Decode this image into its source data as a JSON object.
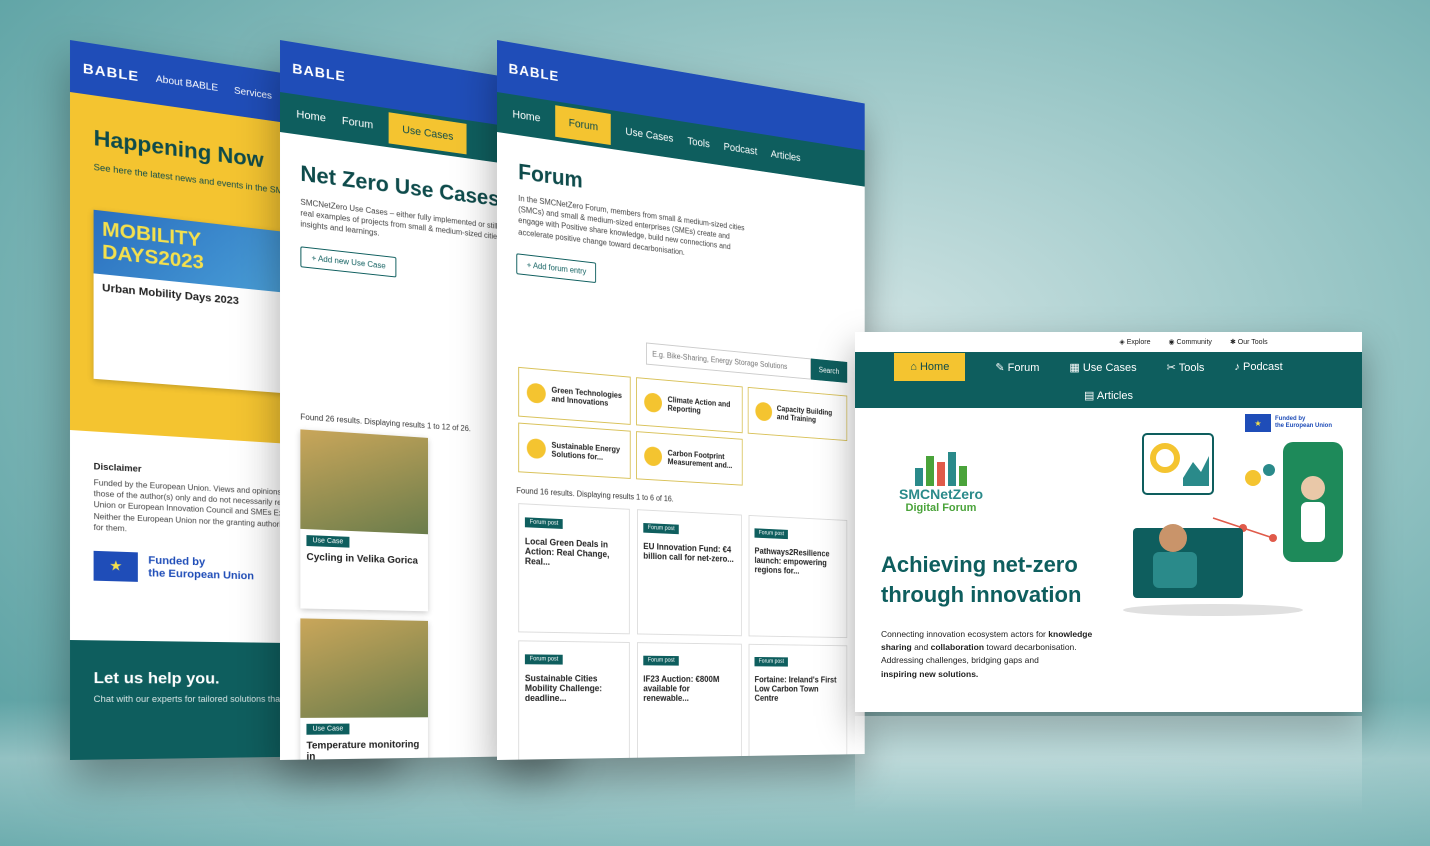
{
  "brand": {
    "logo": "BABLE"
  },
  "panel_happening": {
    "nav": [
      "About BABLE",
      "Services"
    ],
    "title": "Happening Now",
    "text": "See here the latest news and events in the SMCNetZero Project.",
    "event_banner": "MOBILITY DAYS2023",
    "event_name": "Urban Mobility Days 2023",
    "disclaimer_title": "Disclaimer",
    "disclaimer": "Funded by the European Union. Views and opinions expressed are however those of the author(s) only and do not necessarily reflect those of the European Union or European Innovation Council and SMEs Executive Agency (EISMEA). Neither the European Union nor the granting authority can be held responsible for them.",
    "funded_line1": "Funded by",
    "funded_line2": "the European Union",
    "help_title": "Let us help you.",
    "help_sub": "Chat with our experts for tailored solutions that fit your"
  },
  "panel_usecases": {
    "nav": [
      "Home",
      "Forum",
      "Use Cases"
    ],
    "title": "Net Zero Use Cases",
    "text": "SMCNetZero Use Cases – either fully implemented or still ongoing – are real examples of projects from small & medium-sized cities (SMCs) with insights and learnings.",
    "add_button": "+ Add new Use Case",
    "results": "Found 26 results. Displaying results 1 to 12 of 26.",
    "cards": [
      {
        "tag": "Use Case",
        "title": "Cycling in Velika Gorica"
      },
      {
        "tag": "Use Case",
        "title": "Temperature monitoring in"
      }
    ]
  },
  "panel_forum": {
    "nav": [
      "Home",
      "Forum",
      "Use Cases",
      "Tools",
      "Podcast",
      "Articles"
    ],
    "title": "Forum",
    "text": "In the SMCNetZero Forum, members from small & medium-sized cities (SMCs) and small & medium-sized enterprises (SMEs) create and engage with Positive share knowledge, build new connections and accelerate positive change toward decarbonisation.",
    "add_button": "+ Add forum entry",
    "search_placeholder": "E.g. Bike-Sharing, Energy Storage Solutions",
    "search_button": "Search",
    "topics": [
      "Green Technologies and Innovations",
      "Climate Action and Reporting",
      "Capacity Building and Training",
      "Sustainable Energy Solutions for...",
      "Carbon Footprint Measurement and..."
    ],
    "results": "Found 16 results. Displaying results 1 to 6 of 16.",
    "posts": [
      {
        "tag": "Forum post",
        "title": "Local Green Deals in Action: Real Change, Real..."
      },
      {
        "tag": "Forum post",
        "title": "EU Innovation Fund: €4 billion call for net-zero..."
      },
      {
        "tag": "Forum post",
        "title": "Pathways2Resilience launch: empowering regions for..."
      },
      {
        "tag": "Forum post",
        "title": "Sustainable Cities Mobility Challenge: deadline..."
      },
      {
        "tag": "Forum post",
        "title": "IF23 Auction: €800M available for renewable..."
      },
      {
        "tag": "Forum post",
        "title": "Fortaine: Ireland's First Low Carbon Town Centre"
      }
    ]
  },
  "front": {
    "util": [
      "Explore",
      "Community",
      "Our Tools"
    ],
    "nav_row1": [
      "Home",
      "Forum",
      "Use Cases",
      "Tools",
      "Podcast"
    ],
    "nav_row2": "Articles",
    "funded_line1": "Funded by",
    "funded_line2": "the European Union",
    "brand_name": "SMCNetZero",
    "brand_sub": "Digital Forum",
    "headline": "Achieving net-zero through innovation",
    "intro_1": "Connecting innovation ecosystem actors for",
    "intro_bold_1": "knowledge sharing",
    "intro_and": "and",
    "intro_bold_2": "collaboration",
    "intro_2": "toward decarbonisation.",
    "intro_3": "Addressing challenges, bridging gaps and",
    "intro_bold_3": "inspiring new solutions."
  },
  "colors": {
    "teal": "#0e5e5e",
    "yellow": "#f4c430",
    "blue": "#1f4db8"
  }
}
